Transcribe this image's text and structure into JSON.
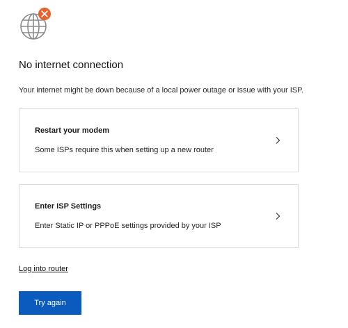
{
  "header": {
    "icon": "globe-disconnected-icon",
    "title": "No internet connection",
    "description": "Your internet might be down because of a local power outage or issue with your ISP."
  },
  "options": [
    {
      "title": "Restart your modem",
      "subtitle": "Some ISPs require this when setting up a new router",
      "icon": "chevron-right-icon"
    },
    {
      "title": "Enter ISP Settings",
      "subtitle": "Enter Static IP or PPPoE settings provided by your ISP",
      "icon": "chevron-right-icon"
    }
  ],
  "link": {
    "label": "Log into router"
  },
  "button": {
    "label": "Try again"
  },
  "colors": {
    "accent": "#0B5BBF",
    "error_badge": "#E8612C",
    "globe": "#8A8A8A"
  }
}
